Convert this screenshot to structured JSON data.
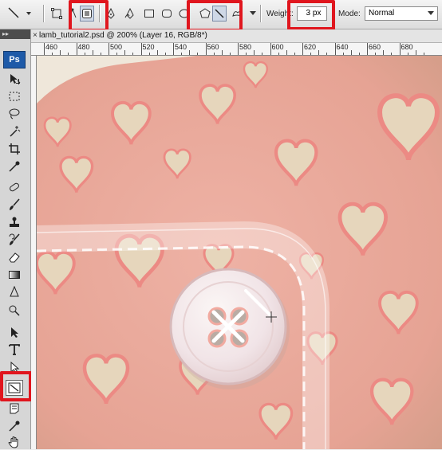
{
  "options_bar": {
    "weight_label": "Weight:",
    "weight_value": "3 px",
    "mode_label": "Mode:",
    "mode_value": "Normal"
  },
  "toolbox": {
    "logo": "Ps",
    "grip": "▸▸",
    "tools": [
      "move-tool",
      "marquee-tool",
      "lasso-tool",
      "magic-wand-tool",
      "crop-tool",
      "eyedropper-tool",
      "healing-brush-tool",
      "brush-tool",
      "clone-stamp-tool",
      "history-brush-tool",
      "eraser-tool",
      "gradient-tool",
      "blur-tool",
      "dodge-tool",
      "path-selection-tool",
      "type-tool",
      "line-tool",
      "notes-tool",
      "eyedropper-tool-2",
      "hand-tool"
    ],
    "active_tool": "line-tool"
  },
  "document": {
    "close_glyph": "×",
    "title": "lamb_tutorial2.psd @ 200% (Layer 16, RGB/8*)"
  },
  "ruler": {
    "labels": [
      "460",
      "480",
      "500",
      "520",
      "540",
      "560",
      "580",
      "600",
      "620",
      "640",
      "660",
      "680"
    ]
  },
  "colors": {
    "highlight": "#e0161e",
    "canvas_pink": "#e8a79b",
    "canvas_beige": "#e9dcc6",
    "heart_fill": "#e6d6bc",
    "heart_outline": "#e98c86"
  }
}
